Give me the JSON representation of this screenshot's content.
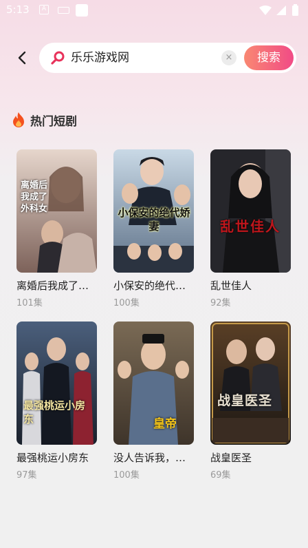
{
  "status_bar": {
    "time": "5:13"
  },
  "search": {
    "query": "乐乐游戏网",
    "clear_label": "×",
    "button_label": "搜索"
  },
  "section": {
    "title": "热门短剧"
  },
  "dramas": [
    {
      "title": "离婚后我成了外科女",
      "title_display": "离婚后我成了…",
      "episodes": "101集",
      "poster_text": "离婚后我成了外科女",
      "colors": [
        "#d9c3b8",
        "#8a6f66"
      ]
    },
    {
      "title": "小保安的绝代娇妻",
      "title_display": "小保安的绝代…",
      "episodes": "100集",
      "poster_text": "小保安的绝代娇妻",
      "colors": [
        "#a9c3d8",
        "#3d4f66"
      ]
    },
    {
      "title": "乱世佳人",
      "title_display": "乱世佳人",
      "episodes": "92集",
      "poster_text": "乱世佳人",
      "colors": [
        "#2b2b2f",
        "#6b1a1a"
      ]
    },
    {
      "title": "最强桃运小房东",
      "title_display": "最强桃运小房东",
      "episodes": "97集",
      "poster_text": "最强桃运小房东",
      "colors": [
        "#3d4f6a",
        "#1b2433"
      ]
    },
    {
      "title": "没人告诉我，我爹是皇帝",
      "title_display": "没人告诉我，…",
      "episodes": "100集",
      "poster_text": "皇帝",
      "colors": [
        "#5a4a3a",
        "#8d6f45"
      ]
    },
    {
      "title": "战皇医圣",
      "title_display": "战皇医圣",
      "episodes": "69集",
      "poster_text": "战皇医圣",
      "colors": [
        "#6b4a2a",
        "#1e1a16"
      ]
    }
  ],
  "colors": {
    "accent_start": "#f98872",
    "accent_end": "#f14b86",
    "search_icon": "#e8325a",
    "fire": "#f4511e"
  }
}
